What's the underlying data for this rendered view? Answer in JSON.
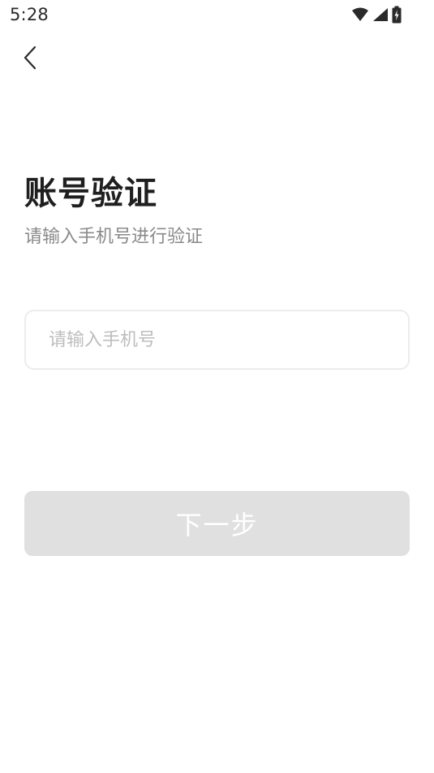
{
  "status_bar": {
    "time": "5:28",
    "icons": [
      "wifi-icon",
      "cellular-signal-icon",
      "battery-charging-icon"
    ]
  },
  "header": {
    "back_icon": "chevron-left-icon"
  },
  "main": {
    "title": "账号验证",
    "subtitle": "请输入手机号进行验证",
    "phone_input": {
      "value": "",
      "placeholder": "请输入手机号"
    },
    "next_button": {
      "label": "下一步",
      "enabled": false
    }
  },
  "colors": {
    "title": "#1f1f1f",
    "subtitle": "#8a8a8a",
    "placeholder": "#bdbdbd",
    "input_border": "#ececec",
    "button_disabled_bg": "#e0e0e0",
    "button_text": "#ffffff"
  }
}
